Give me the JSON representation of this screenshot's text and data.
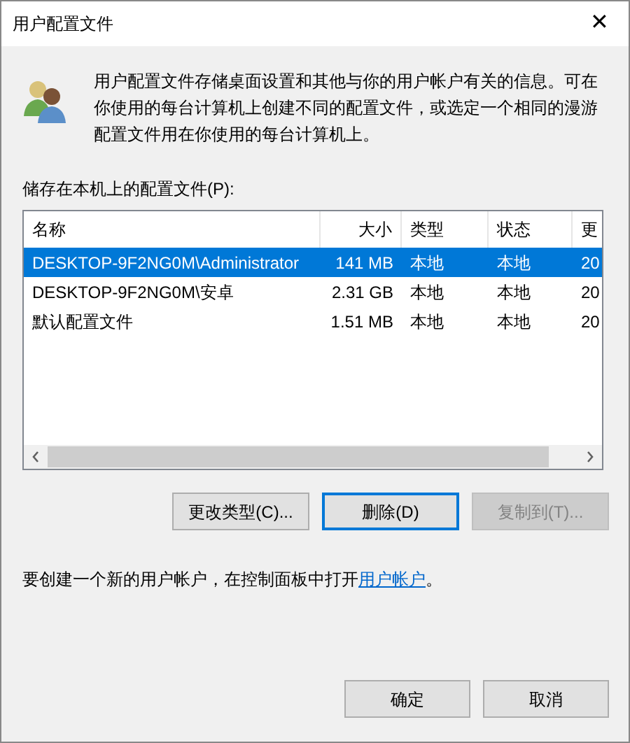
{
  "window": {
    "title": "用户配置文件",
    "close": "✕"
  },
  "description": "用户配置文件存储桌面设置和其他与你的用户帐户有关的信息。可在你使用的每台计算机上创建不同的配置文件，或选定一个相同的漫游配置文件用在你使用的每台计算机上。",
  "list_label": "储存在本机上的配置文件(P):",
  "table": {
    "columns": [
      {
        "label": "名称",
        "kind": "text"
      },
      {
        "label": "大小",
        "kind": "number"
      },
      {
        "label": "类型",
        "kind": "text"
      },
      {
        "label": "状态",
        "kind": "text"
      },
      {
        "label": "更",
        "kind": "text"
      }
    ],
    "rows": [
      {
        "selected": true,
        "cells": [
          "DESKTOP-9F2NG0M\\Administrator",
          "141 MB",
          "本地",
          "本地",
          "20"
        ]
      },
      {
        "selected": false,
        "cells": [
          "DESKTOP-9F2NG0M\\安卓",
          "2.31 GB",
          "本地",
          "本地",
          "20"
        ]
      },
      {
        "selected": false,
        "cells": [
          "默认配置文件",
          "1.51 MB",
          "本地",
          "本地",
          "20"
        ]
      }
    ]
  },
  "actions": [
    {
      "label": "更改类型(C)...",
      "disabled": false,
      "focused": false
    },
    {
      "label": "删除(D)",
      "disabled": false,
      "focused": true
    },
    {
      "label": "复制到(T)...",
      "disabled": true,
      "focused": false
    }
  ],
  "footer": {
    "text": "要创建一个新的用户帐户，在控制面板中打开",
    "link": "用户帐户",
    "end": "。"
  },
  "buttons": [
    {
      "label": "确定",
      "focused": false
    },
    {
      "label": "取消",
      "focused": false
    }
  ]
}
